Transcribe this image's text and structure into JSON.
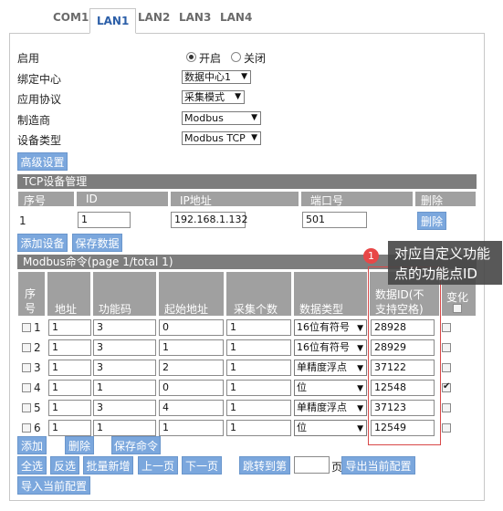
{
  "tabs": [
    "COM1",
    "LAN1",
    "LAN2",
    "LAN3",
    "LAN4"
  ],
  "form": {
    "enable_label": "启用",
    "radio_on": "开启",
    "radio_off": "关闭",
    "datacenter_label": "绑定中心",
    "datacenter_value": "数据中心1",
    "protocol_label": "应用协议",
    "protocol_value": "采集模式",
    "vendor_label": "制造商",
    "vendor_value": "Modbus",
    "devtype_label": "设备类型",
    "devtype_value": "Modbus TCP",
    "advanced_btn": "高级设置"
  },
  "tcp": {
    "title": "TCP设备管理",
    "headers": [
      "序号",
      "ID",
      "IP地址",
      "端口号",
      "删除"
    ],
    "row": {
      "no": "1",
      "id": "1",
      "ip": "192.168.1.132",
      "port": "501",
      "delete": "删除"
    },
    "add_btn": "添加设备",
    "save_btn": "保存数据"
  },
  "modbus": {
    "title": "Modbus命令(page 1/total 1)",
    "headers": {
      "seq_a": "序",
      "seq_b": "号",
      "addr": "地址",
      "func": "功能码",
      "start": "起始地址",
      "count": "采集个数",
      "dtype": "数据类型",
      "dataid_a": "数据ID(不",
      "dataid_b": "支持空格)",
      "change": "变化"
    },
    "rows": [
      {
        "no": "1",
        "addr": "1",
        "func": "3",
        "start": "0",
        "count": "1",
        "dtype": "16位有符号",
        "id": "28928",
        "changed": false
      },
      {
        "no": "2",
        "addr": "1",
        "func": "3",
        "start": "1",
        "count": "1",
        "dtype": "16位有符号",
        "id": "28929",
        "changed": false
      },
      {
        "no": "3",
        "addr": "1",
        "func": "3",
        "start": "2",
        "count": "1",
        "dtype": "单精度浮点",
        "id": "37122",
        "changed": false
      },
      {
        "no": "4",
        "addr": "1",
        "func": "1",
        "start": "0",
        "count": "1",
        "dtype": "位",
        "id": "12548",
        "changed": true
      },
      {
        "no": "5",
        "addr": "1",
        "func": "3",
        "start": "4",
        "count": "1",
        "dtype": "单精度浮点",
        "id": "37123",
        "changed": false
      },
      {
        "no": "6",
        "addr": "1",
        "func": "1",
        "start": "1",
        "count": "1",
        "dtype": "位",
        "id": "12549",
        "changed": false
      }
    ],
    "buttons": {
      "add": "添加",
      "delete": "删除",
      "save": "保存命令",
      "select_all": "全选",
      "invert": "反选",
      "batch_add": "批量新增",
      "prev": "上一页",
      "next": "下一页",
      "goto": "跳转到第",
      "page_unit": "页",
      "export": "导出当前配置",
      "import": "导入当前配置"
    }
  },
  "callout": {
    "badge": "1",
    "text_line1": "对应自定义功能",
    "text_line2": "点的功能点ID"
  }
}
